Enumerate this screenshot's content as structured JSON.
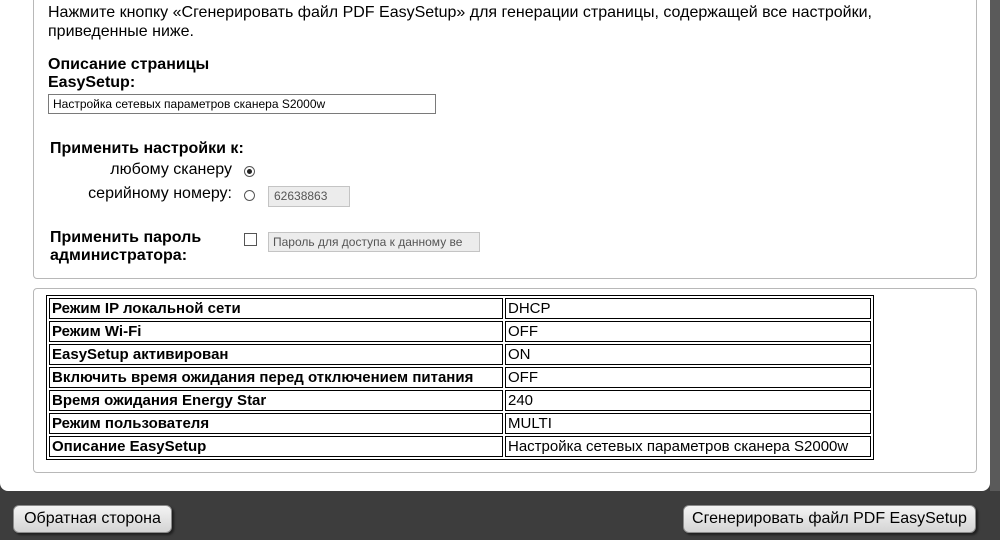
{
  "intro_text": "Нажмите кнопку «Сгенерировать файл PDF EasySetup» для генерации страницы, содержащей все настройки, приведенные ниже.",
  "description": {
    "label_line1": "Описание страницы",
    "label_line2": "EasySetup:",
    "value": "Настройка сетевых параметров сканера S2000w"
  },
  "apply_to": {
    "label": "Применить настройки к:",
    "options": [
      {
        "label": "любому сканеру",
        "checked": true
      },
      {
        "label": "серийному номеру:",
        "checked": false
      }
    ],
    "serial_value": "62638863"
  },
  "admin_password": {
    "label_line1": "Применить пароль",
    "label_line2": "администратора:",
    "checked": false,
    "placeholder": "Пароль для доступа к данному ве"
  },
  "settings_table": [
    {
      "key": "Режим IP локальной сети",
      "value": "DHCP"
    },
    {
      "key": "Режим Wi-Fi",
      "value": "OFF"
    },
    {
      "key": "EasySetup активирован",
      "value": "ON"
    },
    {
      "key": "Включить время ожидания перед отключением питания",
      "value": "OFF"
    },
    {
      "key": "Время ожидания Energy Star",
      "value": "240"
    },
    {
      "key": "Режим пользователя",
      "value": "MULTI"
    },
    {
      "key": "Описание EasySetup",
      "value": "Настройка сетевых параметров сканера S2000w"
    }
  ],
  "buttons": {
    "back": "Обратная сторона",
    "generate": "Сгенерировать файл PDF EasySetup"
  }
}
